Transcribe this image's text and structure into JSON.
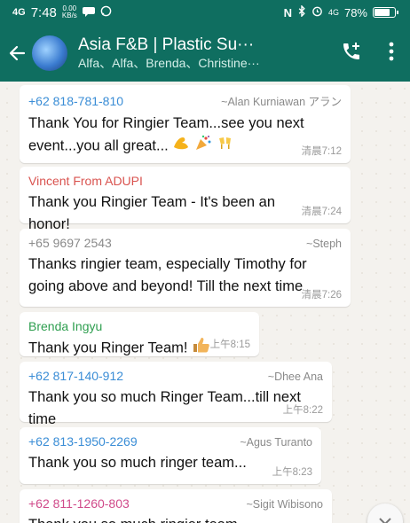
{
  "status_bar": {
    "signal": "4G",
    "time": "7:48",
    "speed_value": "0.00",
    "speed_unit": "KB/s",
    "network": "4G",
    "battery": "78%",
    "battery_level": 0.78
  },
  "header": {
    "title": "Asia F&B | Plastic Su···",
    "subtitle": "Alfa、Alfa、Brenda、Christine···"
  },
  "messages": [
    {
      "sender": "+62 818-781-810",
      "alias": "~Alan Kurniawan アラン",
      "text": "Thank You for Ringier Team...see you next event...you all great...",
      "time": "清晨7:12",
      "sender_color": "#3a8dd6"
    },
    {
      "sender": "Vincent From ADUPI",
      "alias": "",
      "text": "Thank you Ringier Team - It's been an honor!",
      "time": "清晨7:24",
      "sender_color": "#d9534f"
    },
    {
      "sender": "+65 9697 2543",
      "alias": "~Steph",
      "text": "Thanks ringier team, especially Timothy for going above and beyond! Till the next time",
      "time": "清晨7:26",
      "sender_color": "#8a8a8a"
    },
    {
      "sender": "Brenda Ingyu",
      "alias": "",
      "text": "Thank you Ringer Team!",
      "time": "上午8:15",
      "sender_color": "#2e9e4f"
    },
    {
      "sender": "+62 817-140-912",
      "alias": "~Dhee Ana",
      "text": "Thank you so much Ringer Team...till next time",
      "time": "上午8:22",
      "sender_color": "#3a8dd6"
    },
    {
      "sender": "+62 813-1950-2269",
      "alias": "~Agus Turanto",
      "text": "Thank you so much ringer team...",
      "time": "上午8:23",
      "sender_color": "#3a8dd6"
    },
    {
      "sender": "+62 811-1260-803",
      "alias": "~Sigit Wibisono",
      "text": "Thank you so much ringier team...",
      "time": "",
      "sender_color": "#d04a8a"
    }
  ]
}
